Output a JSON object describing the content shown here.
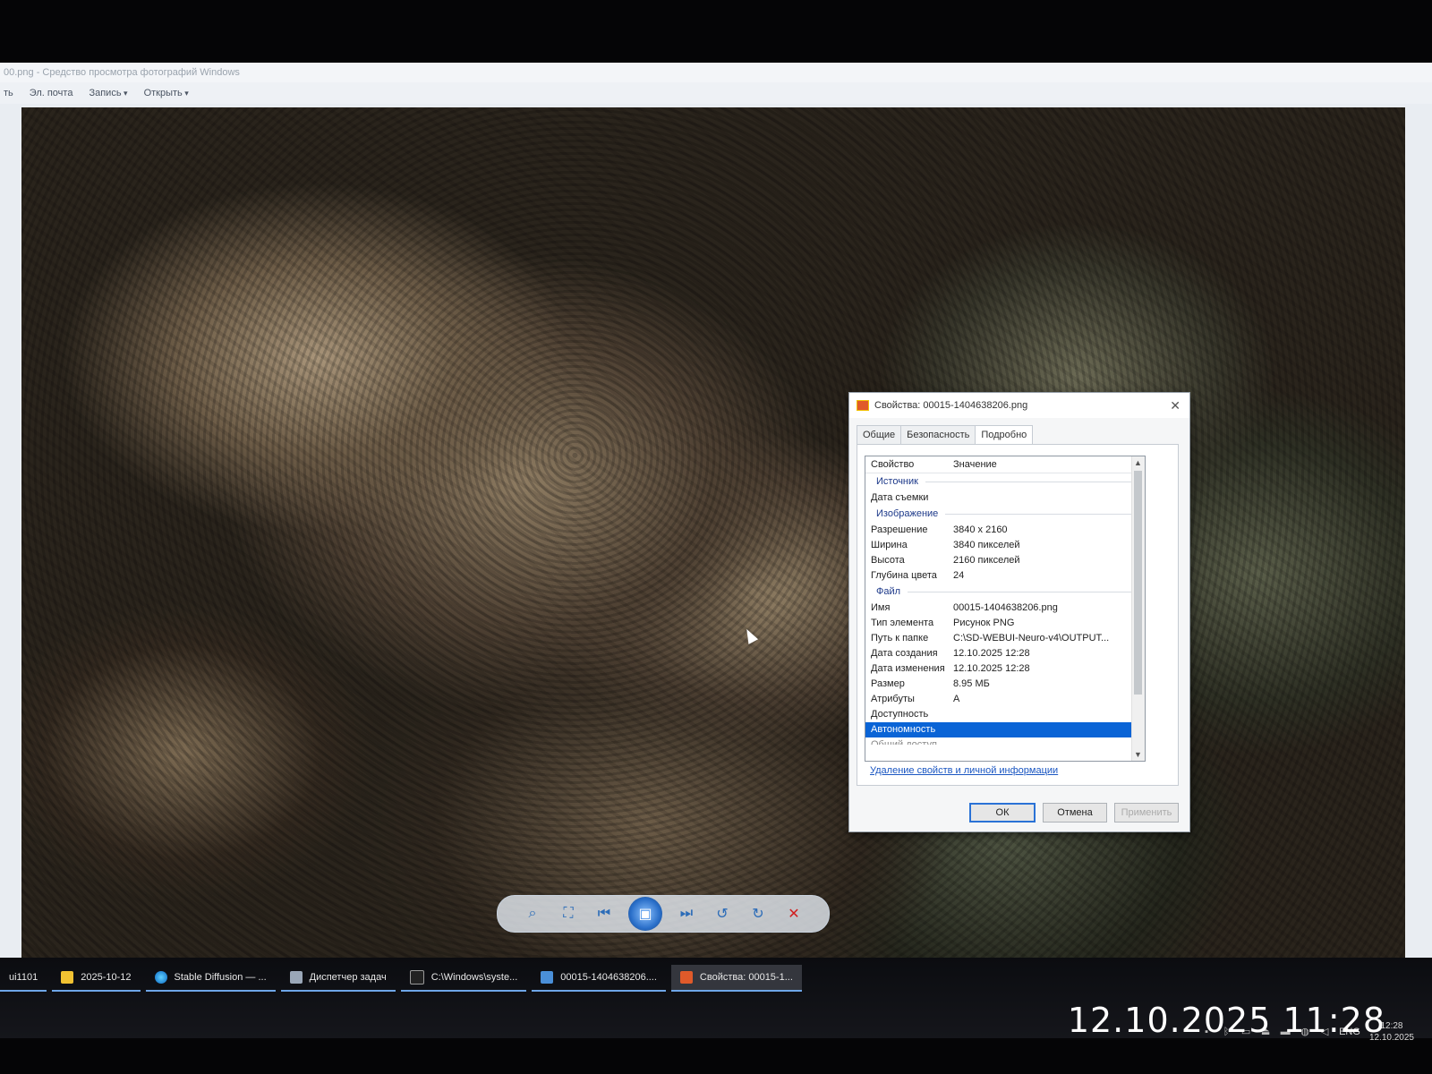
{
  "window": {
    "title": "00.png - Средство просмотра фотографий Windows"
  },
  "menu": {
    "items": [
      {
        "label": "ть"
      },
      {
        "label": "Эл. почта"
      },
      {
        "label": "Запись"
      },
      {
        "label": "Открыть"
      }
    ]
  },
  "viewer_toolbar": {
    "zoom_icon": "magnifier-icon",
    "fit_icon": "fit-window-icon",
    "prev_icon": "previous-icon",
    "slideshow_icon": "slideshow-icon",
    "next_icon": "next-icon",
    "rotate_left_icon": "rotate-ccw-icon",
    "rotate_right_icon": "rotate-cw-icon",
    "delete_icon": "delete-x-icon"
  },
  "dialog": {
    "title": "Свойства: 00015-1404638206.png",
    "tabs": [
      {
        "label": "Общие"
      },
      {
        "label": "Безопасность"
      },
      {
        "label": "Подробно"
      }
    ],
    "columns": {
      "property": "Свойство",
      "value": "Значение"
    },
    "groups": {
      "source": "Источник",
      "image": "Изображение",
      "file": "Файл"
    },
    "rows": {
      "date_taken": {
        "k": "Дата съемки",
        "v": ""
      },
      "resolution": {
        "k": "Разрешение",
        "v": "3840 x 2160"
      },
      "width": {
        "k": "Ширина",
        "v": "3840 пикселей"
      },
      "height": {
        "k": "Высота",
        "v": "2160 пикселей"
      },
      "bit_depth": {
        "k": "Глубина цвета",
        "v": "24"
      },
      "name": {
        "k": "Имя",
        "v": "00015-1404638206.png"
      },
      "type": {
        "k": "Тип элемента",
        "v": "Рисунок PNG"
      },
      "path": {
        "k": "Путь к папке",
        "v": "C:\\SD-WEBUI-Neuro-v4\\OUTPUT..."
      },
      "created": {
        "k": "Дата создания",
        "v": "12.10.2025 12:28"
      },
      "modified": {
        "k": "Дата изменения",
        "v": "12.10.2025 12:28"
      },
      "size": {
        "k": "Размер",
        "v": "8.95 МБ"
      },
      "attributes": {
        "k": "Атрибуты",
        "v": "A"
      },
      "availability": {
        "k": "Доступность",
        "v": ""
      },
      "offline": {
        "k": "Автономность",
        "v": ""
      },
      "shared": {
        "k": "Общий доступ",
        "v": ""
      }
    },
    "remove_link": "Удаление свойств и личной информации",
    "buttons": {
      "ok": "ОК",
      "cancel": "Отмена",
      "apply": "Применить"
    }
  },
  "taskbar": {
    "items": [
      {
        "label": "ui1101"
      },
      {
        "label": "2025-10-12"
      },
      {
        "label": "Stable Diffusion — ..."
      },
      {
        "label": "Диспетчер задач"
      },
      {
        "label": "C:\\Windows\\syste..."
      },
      {
        "label": "00015-1404638206...."
      },
      {
        "label": "Свойства: 00015-1..."
      }
    ],
    "tray": {
      "lang": "ENG",
      "time": "12:28",
      "date": "12.10.2025"
    }
  },
  "photo_timestamp": "12.10.2025 11:28"
}
